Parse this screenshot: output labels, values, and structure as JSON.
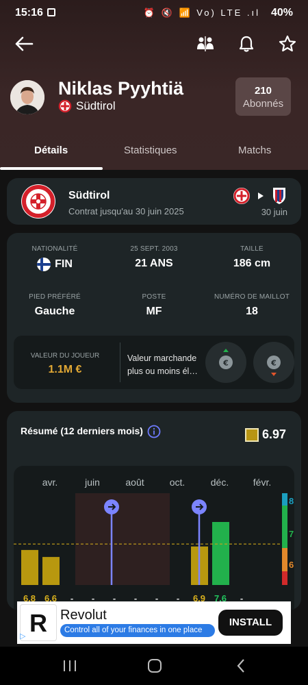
{
  "status_bar": {
    "time": "15:16",
    "icons": "⏰ 🔇 📶 Vo) LTE .ıl",
    "battery": "40%"
  },
  "player": {
    "name": "Niklas Pyyhtiä",
    "club": "Südtirol",
    "followers_count": "210",
    "followers_label": "Abonnés"
  },
  "tabs": [
    {
      "label": "Détails",
      "active": true
    },
    {
      "label": "Statistiques",
      "active": false
    },
    {
      "label": "Matchs",
      "active": false
    }
  ],
  "contract": {
    "club": "Südtirol",
    "until": "Contrat jusqu'au 30 juin 2025",
    "transfer_date": "30 juin"
  },
  "info": {
    "nationality_label": "NATIONALITÉ",
    "nationality": "FIN",
    "birth_label": "25 SEPT. 2003",
    "age": "21 ANS",
    "height_label": "TAILLE",
    "height": "186 cm",
    "foot_label": "PIED PRÉFÉRÉ",
    "foot": "Gauche",
    "position_label": "POSTE",
    "position": "MF",
    "shirt_label": "NUMÉRO DE MAILLOT",
    "shirt": "18"
  },
  "market_value": {
    "label": "VALEUR DU JOUEUR",
    "value": "1.1M €",
    "question": "Valeur marchande plus ou moins él…"
  },
  "summary": {
    "title": "Résumé (12 derniers mois)",
    "average_rating": "6.97"
  },
  "chart_data": {
    "type": "bar",
    "month_labels": [
      "avr.",
      "juin",
      "août",
      "oct.",
      "déc.",
      "févr."
    ],
    "values": [
      6.8,
      6.6,
      null,
      null,
      null,
      null,
      null,
      null,
      6.9,
      7.6,
      null
    ],
    "value_labels": [
      "6.8",
      "6.6",
      "-",
      "-",
      "-",
      "-",
      "-",
      "-",
      "6.9",
      "7.6",
      "-"
    ],
    "bar_colors": [
      "#b8980f",
      "#b8980f",
      null,
      null,
      null,
      null,
      null,
      null,
      "#b8980f",
      "#22b14c",
      null
    ],
    "scale_labels": [
      "8",
      "7",
      "6"
    ],
    "scale_colors": [
      "#1b9fc0",
      "#22b14c",
      "#e2882b",
      "#d12a2a"
    ],
    "reference_line": 6.97,
    "ylim": [
      5.8,
      8.5
    ],
    "highlight_range": [
      2,
      4
    ],
    "transfer_markers": [
      2,
      8
    ]
  },
  "ad": {
    "name": "Revolut",
    "tagline": "Control all of your finances in one place",
    "cta": "INSTALL"
  }
}
